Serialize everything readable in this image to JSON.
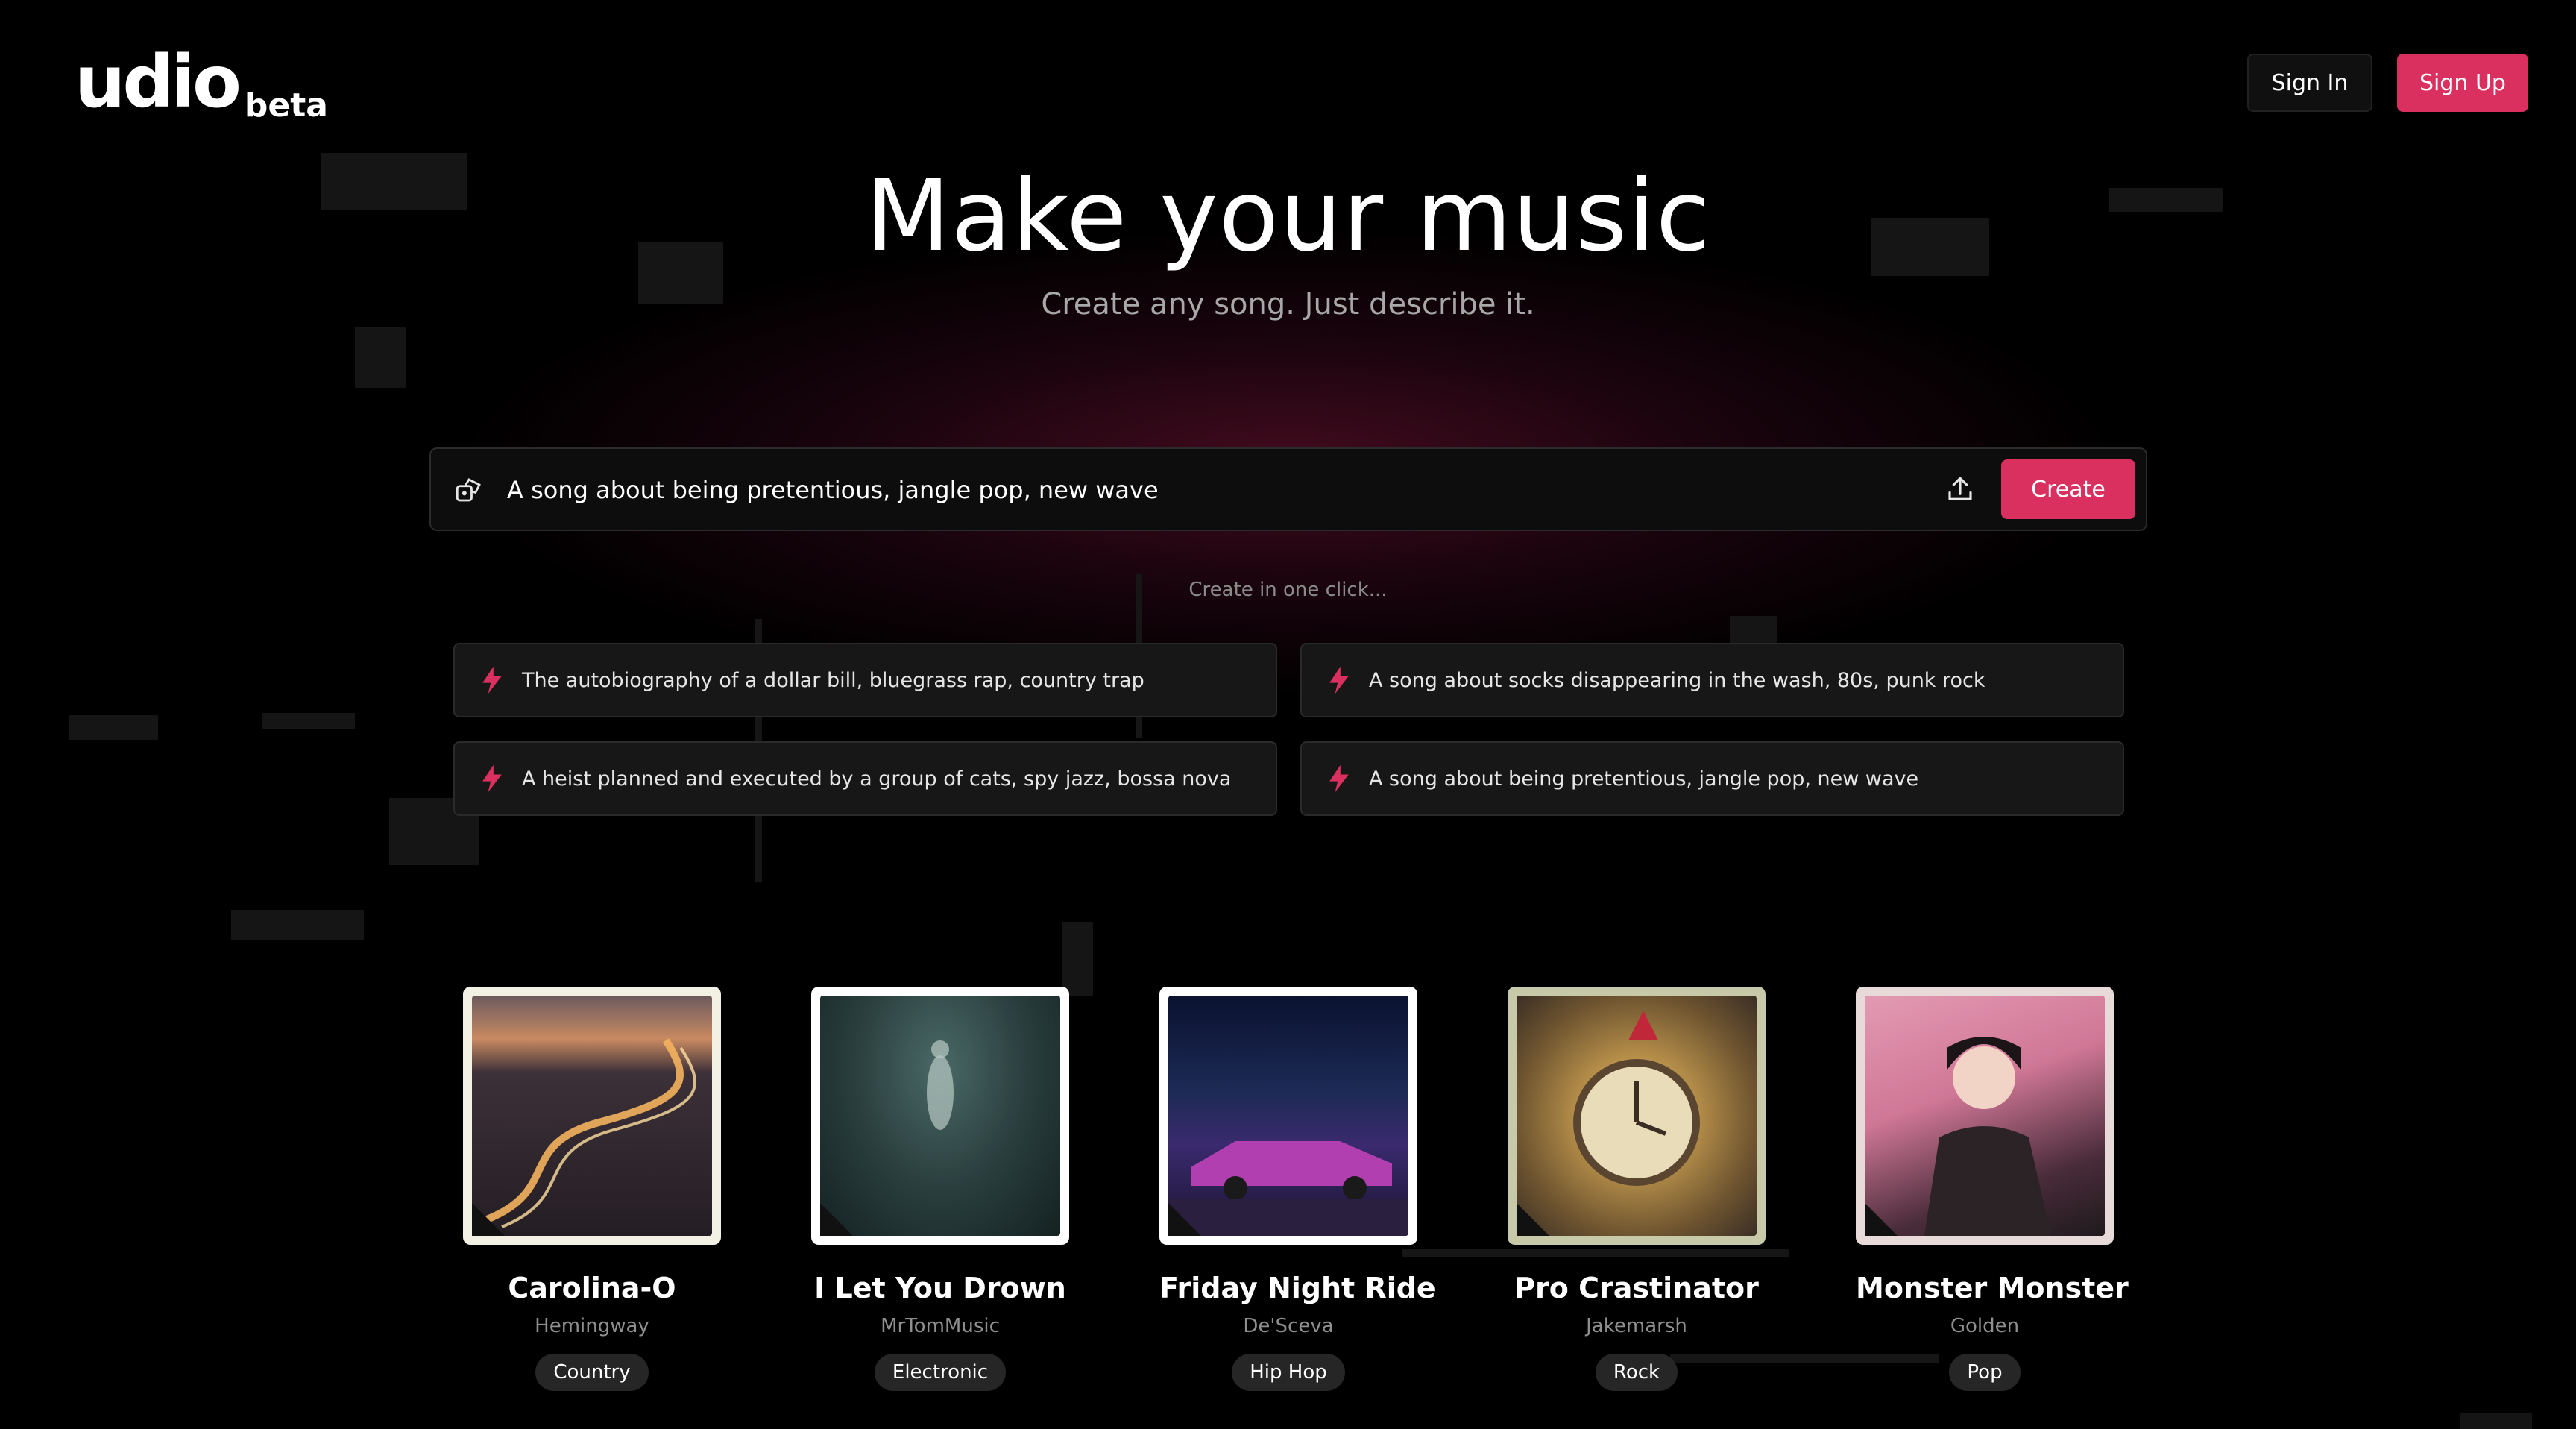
{
  "header": {
    "logo": "udio",
    "logo_badge": "beta",
    "sign_in_label": "Sign In",
    "sign_up_label": "Sign Up"
  },
  "hero": {
    "title": "Make your music",
    "subtitle": "Create any song. Just describe it."
  },
  "prompt": {
    "value": "A song about being pretentious, jangle pop, new wave",
    "create_label": "Create"
  },
  "suggestions": {
    "heading": "Create in one click...",
    "items": [
      "The autobiography of a dollar bill, bluegrass rap, country trap",
      "A song about socks disappearing in the wash, 80s, punk rock",
      "A heist planned and executed by a group of cats, spy jazz, bossa nova",
      "A song about being pretentious, jangle pop, new wave"
    ]
  },
  "songs": [
    {
      "title": "Carolina-O",
      "artist": "Hemingway",
      "genre": "Country",
      "frame_color": "#f3f0e4"
    },
    {
      "title": "I Let You Drown",
      "artist": "MrTomMusic",
      "genre": "Electronic",
      "frame_color": "#ffffff"
    },
    {
      "title": "Friday Night Ride",
      "artist": "De'Sceva",
      "genre": "Hip Hop",
      "frame_color": "#ffffff"
    },
    {
      "title": "Pro Crastinator",
      "artist": "Jakemarsh",
      "genre": "Rock",
      "frame_color": "#c7c9a9"
    },
    {
      "title": "Monster Monster",
      "artist": "Golden",
      "genre": "Pop",
      "frame_color": "#e9dada"
    }
  ],
  "colors": {
    "accent": "#d9305f",
    "background": "#000000"
  },
  "icons": {
    "prompt": "dice-icon",
    "upload": "upload-icon",
    "suggestion": "lightning-icon"
  }
}
